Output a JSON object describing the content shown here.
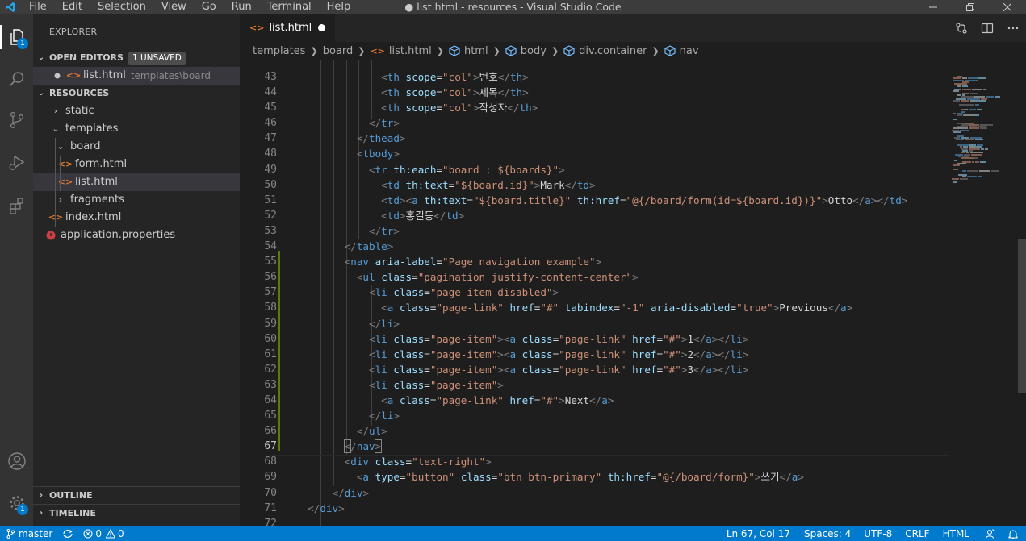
{
  "window": {
    "title": "● list.html - resources - Visual Studio Code",
    "menu": [
      "File",
      "Edit",
      "Selection",
      "View",
      "Go",
      "Run",
      "Terminal",
      "Help"
    ]
  },
  "activity_bar": {
    "items": [
      "explorer-icon",
      "search-icon",
      "source-control-icon",
      "run-debug-icon",
      "extensions-icon"
    ],
    "explorer_badge": "1",
    "accounts": "account-icon",
    "settings": "gear-icon",
    "settings_badge": "1"
  },
  "sidebar": {
    "title": "EXPLORER",
    "open_editors": {
      "label": "OPEN EDITORS",
      "badge": "1 UNSAVED",
      "file": "list.html",
      "path": "templates\\board"
    },
    "workspace": {
      "label": "RESOURCES",
      "items": [
        {
          "label": "static"
        },
        {
          "label": "templates"
        },
        {
          "label": "board"
        },
        {
          "label": "form.html"
        },
        {
          "label": "list.html"
        },
        {
          "label": "fragments"
        },
        {
          "label": "index.html"
        },
        {
          "label": "application.properties"
        }
      ]
    },
    "outline_label": "OUTLINE",
    "timeline_label": "TIMELINE"
  },
  "editor": {
    "tab": {
      "label": "list.html",
      "modified": true
    },
    "breadcrumb": [
      "templates",
      "board",
      "list.html",
      "html",
      "body",
      "div.container",
      "nav"
    ],
    "line_numbers": [
      "43",
      "44",
      "45",
      "46",
      "47",
      "48",
      "49",
      "50",
      "51",
      "52",
      "53",
      "54",
      "55",
      "56",
      "57",
      "58",
      "59",
      "60",
      "61",
      "62",
      "63",
      "64",
      "65",
      "66",
      "67",
      "68",
      "69",
      "70",
      "71",
      "72"
    ],
    "current_line": "67"
  },
  "status_bar": {
    "branch": "master",
    "errors": "0",
    "warnings": "0",
    "position": "Ln 67, Col 17",
    "indent": "Spaces: 4",
    "encoding": "UTF-8",
    "eol": "CRLF",
    "language": "HTML"
  },
  "colors": {
    "accent": "#007acc",
    "tag": "#569cd6",
    "attribute": "#9cdcfe",
    "string": "#ce9178",
    "modified_gutter": "#587c0c"
  }
}
